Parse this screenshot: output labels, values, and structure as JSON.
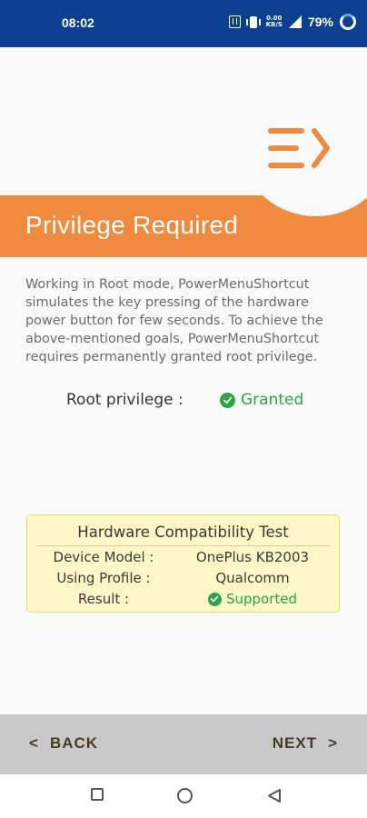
{
  "status_bar": {
    "time": "08:02",
    "data_speed_top": "0.00",
    "data_speed_bottom": "KB/S",
    "battery_percent": "79%"
  },
  "header": {
    "title": "Privilege Required",
    "accent_color": "#f08a3e",
    "logo_icon": "menu-arrow-logo-icon"
  },
  "body": {
    "description": "Working in Root mode, PowerMenuShortcut simulates the key pressing of the hardware power button for few seconds. To achieve the above-mentioned goals, PowerMenuShortcut requires permanently granted root privilege.",
    "root_label": "Root privilege :",
    "root_status": "Granted",
    "status_color": "#27a844"
  },
  "compat": {
    "title": "Hardware Compatibility Test",
    "rows": [
      {
        "key": "Device Model :",
        "value": "OnePlus KB2003"
      },
      {
        "key": "Using Profile :",
        "value": "Qualcomm"
      },
      {
        "key": "Result :",
        "value": "Supported"
      }
    ]
  },
  "nav": {
    "back_label": "BACK",
    "back_arrow": "<",
    "next_label": "NEXT",
    "next_arrow": ">"
  }
}
